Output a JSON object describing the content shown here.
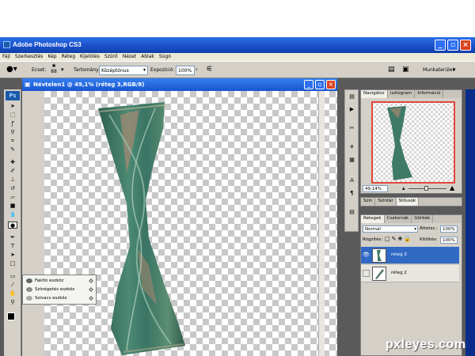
{
  "app": {
    "title": "Adobe Photoshop CS3"
  },
  "menu": [
    "Fájl",
    "Szerkesztés",
    "Kép",
    "Réteg",
    "Kijelölés",
    "Szűrő",
    "Nézet",
    "Ablak",
    "Súgó"
  ],
  "options": {
    "ecset_label": "Ecset:",
    "ecset_value": "88",
    "tartomany_label": "Tartomány:",
    "tartomany_value": "Középtónus",
    "expozicio_label": "Expozíció:",
    "expozicio_value": "100%",
    "workspace": "Munkaterület"
  },
  "document": {
    "title": "Névtelen1 @ 49,1% (réteg 3,RGB/8)"
  },
  "toolbox": {
    "logo": "Ps"
  },
  "flyout": {
    "items": [
      "Fakító eszköz",
      "Színégetés eszköz",
      "Szivacs eszköz"
    ]
  },
  "navigator": {
    "tabs": [
      "Navigátor",
      "isztogram",
      "Információ"
    ],
    "zoom": "49,14%"
  },
  "color_panel": {
    "tabs": [
      "Szín",
      "Színtár",
      "Stílusok"
    ]
  },
  "layers_panel": {
    "tabs": [
      "Rétegek",
      "Csatornák",
      "Görbék"
    ],
    "blend_mode": "Normál",
    "opacity_label": "Áttetsz.:",
    "opacity_value": "100%",
    "lock_label": "Rögzítés:",
    "fill_label": "Kitöltés:",
    "fill_value": "100%",
    "layers": [
      {
        "name": "réteg 3",
        "selected": true
      },
      {
        "name": "réteg 2",
        "selected": false
      }
    ]
  },
  "watermark": "pxleyes.com",
  "colors": {
    "title_bar": "#1a4fc9",
    "selection": "#316ac5",
    "nav_frame": "#e2473a",
    "object_green": "#3f7a66"
  }
}
